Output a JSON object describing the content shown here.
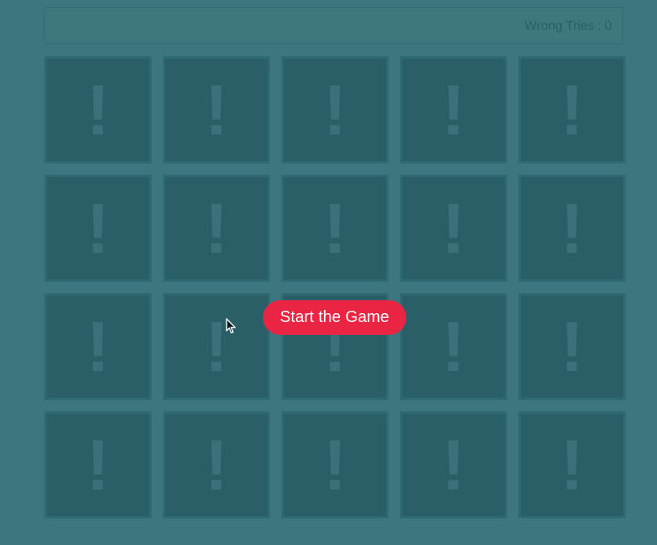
{
  "info_bar": {
    "wrong_tries_label": "Wrong Tries : 0"
  },
  "cards": [
    {
      "symbol": "!"
    },
    {
      "symbol": "!"
    },
    {
      "symbol": "!"
    },
    {
      "symbol": "!"
    },
    {
      "symbol": "!"
    },
    {
      "symbol": "!"
    },
    {
      "symbol": "!"
    },
    {
      "symbol": "!"
    },
    {
      "symbol": "!"
    },
    {
      "symbol": "!"
    },
    {
      "symbol": "!"
    },
    {
      "symbol": "!"
    },
    {
      "symbol": "!"
    },
    {
      "symbol": "!"
    },
    {
      "symbol": "!"
    },
    {
      "symbol": "!"
    },
    {
      "symbol": "!"
    },
    {
      "symbol": "!"
    },
    {
      "symbol": "!"
    },
    {
      "symbol": "!"
    }
  ],
  "start_button": {
    "label": "Start the Game"
  },
  "colors": {
    "background": "#3d767e",
    "card": "#2a5f67",
    "accent": "#ea2544"
  },
  "cursor": {
    "icon": "mouse-pointer-icon"
  }
}
